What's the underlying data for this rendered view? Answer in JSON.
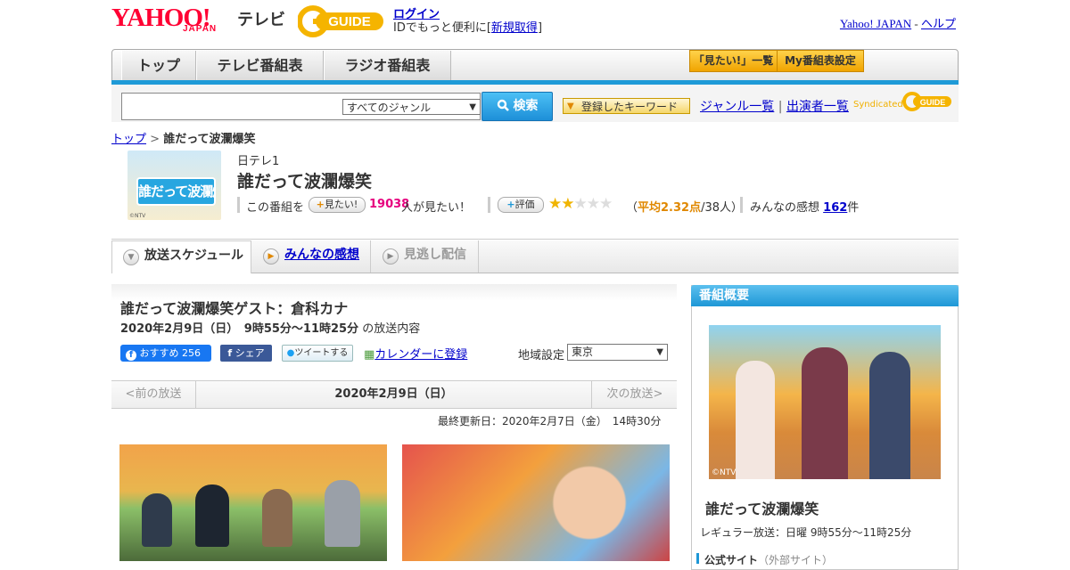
{
  "header": {
    "logo_yahoo": "YAHOO!",
    "logo_japan": "JAPAN",
    "logo_tv": "テレビ",
    "gguide_text": "GUIDE",
    "login_label": "ログイン",
    "login_sub_prefix": "IDでもっと便利に[",
    "signup_label": "新規取得",
    "login_sub_suffix": "]",
    "yahoo_japan_link": "Yahoo! JAPAN",
    "separator": "-",
    "help_link": "ヘルプ"
  },
  "nav": {
    "tabs": [
      "トップ",
      "テレビ番組表",
      "ラジオ番組表"
    ],
    "mitai_list": "「見たい!」一覧",
    "my_schedule": "My番組表設定"
  },
  "search": {
    "genre_selected": "すべてのジャンル",
    "search_button": "検索",
    "keyword_button": "登録したキーワード",
    "genre_list": "ジャンル一覧",
    "divider": "|",
    "performer_list": "出演者一覧",
    "syndicated": "Syndicated"
  },
  "breadcrumb": {
    "home": "トップ",
    "sep": ">",
    "current": "誰だって波瀾爆笑"
  },
  "program": {
    "thumb_title": "誰だって波瀾爆笑",
    "thumb_credit": "©NTV",
    "channel": "日テレ1",
    "title": "誰だって波瀾爆笑",
    "mitai_prefix": "この番組を",
    "mitai_button": "見たい!",
    "mitai_count": "19038",
    "mitai_suffix": "人が見たい！",
    "rate_button": "評価",
    "rating_stars_filled": 2,
    "rating_stars_total": 5,
    "rating_open": "（",
    "rating_avg": "平均2.32点",
    "rating_count": "/38人",
    "rating_close": "）",
    "impressions_label": "みんなの感想",
    "impressions_count": "162",
    "impressions_unit": "件"
  },
  "tabs": {
    "schedule": "放送スケジュール",
    "impressions": "みんなの感想",
    "missed": "見逃し配信"
  },
  "episode": {
    "title": "誰だって波瀾爆笑ゲスト：倉科カナ",
    "date_time": "2020年2月9日（日）　9時55分～11時25分",
    "date_suffix": "の放送内容",
    "fb_label": "おすすめ",
    "fb_count": "256",
    "share": "シェア",
    "tweet": "ツイートする",
    "calendar": "カレンダーに登録",
    "region_label": "地域設定",
    "region_selected": "東京",
    "prev": "<前の放送",
    "current_date": "2020年2月9日（日）",
    "next": "次の放送>",
    "updated": "最終更新日：2020年2月7日（金）　14時30分"
  },
  "sidebar": {
    "header": "番組概要",
    "photo_credit": "©NTV",
    "title": "誰だって波瀾爆笑",
    "regular": "レギュラー放送：日曜 9時55分～11時25分",
    "official_site": "公式サイト",
    "official_note": "（外部サイト）"
  },
  "colors": {
    "yahoo_red": "#ff0033",
    "nav_blue": "#1e9ad7",
    "mitai_pink": "#e6007e",
    "rating_orange": "#e08800",
    "star_gold": "#f0b400"
  }
}
